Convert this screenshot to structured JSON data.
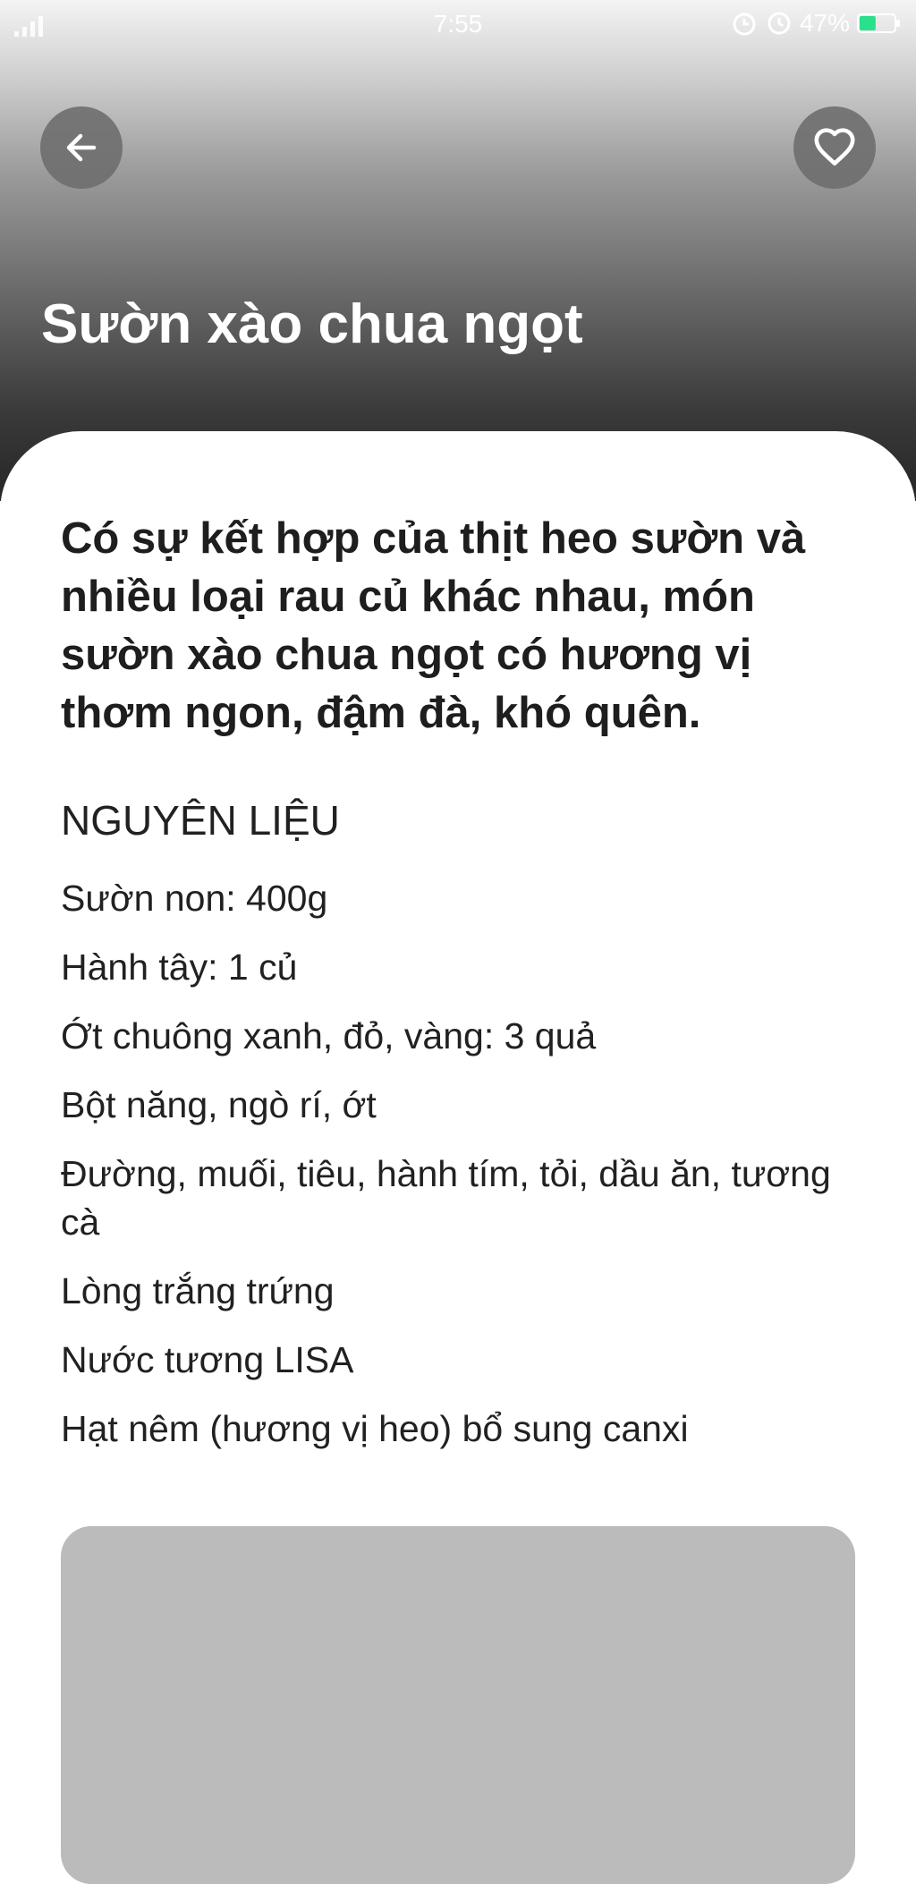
{
  "status_bar": {
    "time": "7:55",
    "battery_percent": "47%",
    "battery_level": 0.47,
    "battery_color": "#2be08a",
    "icons": [
      "signal-icon",
      "alarm-icon",
      "timer-icon",
      "battery-icon"
    ]
  },
  "nav": {
    "back_icon": "arrow-left-icon",
    "favorite_icon": "heart-outline-icon"
  },
  "recipe": {
    "title": "Sườn xào chua ngọt",
    "description": "Có sự kết hợp của thịt heo sườn và nhiều loại rau củ khác nhau, món sườn xào chua ngọt có hương vị thơm ngon, đậm đà, khó quên.",
    "ingredients_heading": "NGUYÊN LIỆU",
    "ingredients": [
      "Sườn non: 400g",
      "Hành tây: 1 củ",
      "Ớt chuông xanh, đỏ, vàng: 3 quả",
      "Bột năng, ngò rí, ớt",
      "Đường, muối, tiêu, hành tím, tỏi, dầu ăn, tương cà",
      "Lòng trắng trứng",
      "Nước tương LISA",
      "Hạt nêm (hương vị heo) bổ sung canxi"
    ]
  }
}
